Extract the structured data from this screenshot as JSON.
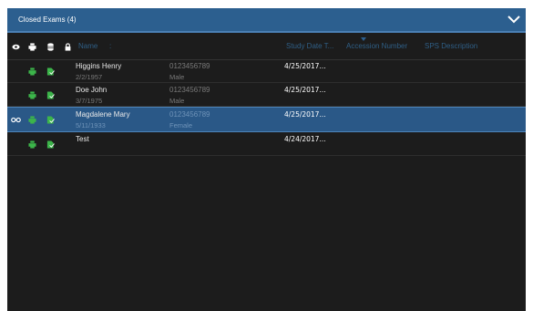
{
  "header": {
    "title": "Closed Exams (4)"
  },
  "columns": {
    "name": "Name",
    "study_date": "Study Date T...",
    "accession": "Accession Number",
    "sps": "SPS Description"
  },
  "rows": [
    {
      "name": "Higgins Henry",
      "dob": "2/2/1957",
      "patient_id": "0123456789",
      "sex": "Male",
      "study_date": "4/25/2017..."
    },
    {
      "name": "Doe John",
      "dob": "3/7/1975",
      "patient_id": "0123456789",
      "sex": "Male",
      "study_date": "4/25/2017..."
    },
    {
      "name": "Magdalene Mary",
      "dob": "5/11/1933",
      "patient_id": "0123456789",
      "sex": "Female",
      "study_date": "4/25/2017...",
      "selected": true
    },
    {
      "name": "Test",
      "dob": "",
      "patient_id": "",
      "sex": "",
      "study_date": "4/24/2017..."
    }
  ],
  "colors": {
    "header_bg": "#2c5f8f",
    "panel_bg": "#1c1c1c",
    "selected_row": "#2a5887",
    "icon_green": "#3cb54a"
  },
  "icons": [
    "eye-icon",
    "printer-icon",
    "database-icon",
    "lock-icon",
    "glasses-icon",
    "chevron-down-icon"
  ]
}
